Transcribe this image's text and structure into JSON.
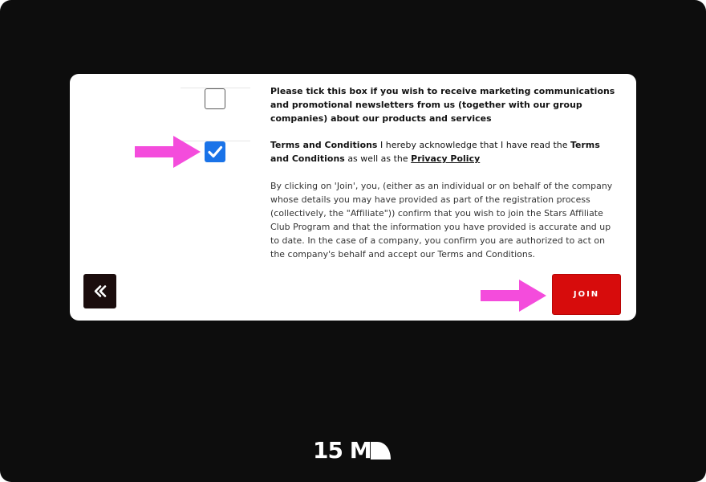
{
  "form": {
    "marketing_text": "Please tick this box if you wish to receive marketing communications and promotional newsletters from us (together with our group companies) about our products and services",
    "terms": {
      "title": "Terms and Conditions",
      "part1": " I hereby acknowledge that I have read the ",
      "title2": "Terms and Conditions",
      "part2": " as well as the ",
      "privacy_link": "Privacy Policy"
    },
    "consent_text": "By clicking on 'Join', you, (either as an individual or on behalf of the company whose details you may have provided as part of the registration process (collectively, the \"Affiliate\")) confirm that you wish to join the Stars Affiliate Club Program and that the information you have provided is accurate and up to date. In the case of a company, you confirm you are authorized to act on the company's behalf and accept our Terms and Conditions.",
    "marketing_checked": false,
    "terms_checked": true
  },
  "buttons": {
    "join_label": "JOIN",
    "back_icon": "double-chevron-left-icon"
  },
  "annotations": {
    "arrow_color": "#f44cdc"
  },
  "brand": {
    "logo_text": "15 M"
  },
  "colors": {
    "background": "#0d0d0d",
    "card": "#ffffff",
    "checkbox_checked": "#1a73e8",
    "join_button": "#d70c0c"
  }
}
